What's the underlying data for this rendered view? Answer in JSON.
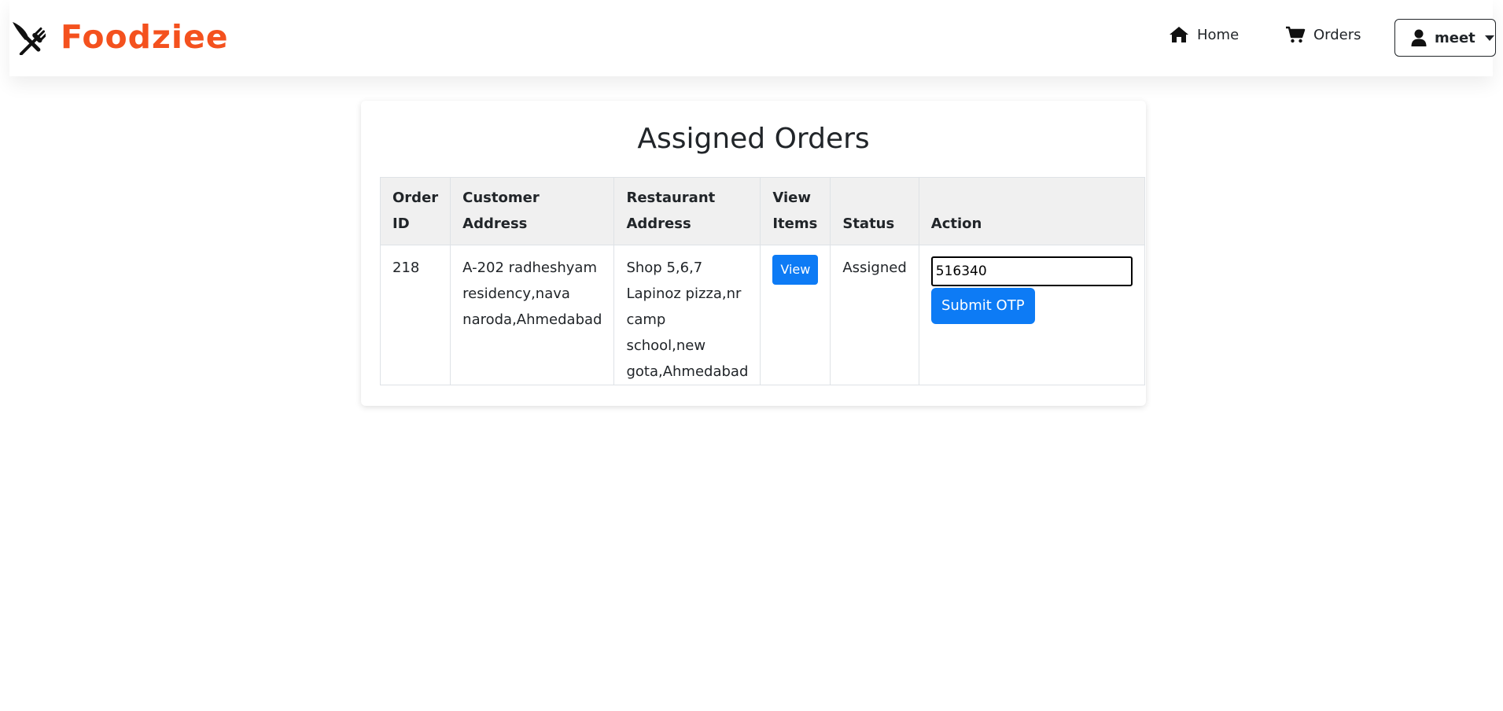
{
  "brand": {
    "name": "Foodziee",
    "color": "#f4511e",
    "icon": "fork-knife-icon"
  },
  "nav": {
    "home": {
      "label": "Home",
      "icon": "home-icon"
    },
    "orders": {
      "label": "Orders",
      "icon": "cart-icon"
    },
    "user": {
      "label": "meet",
      "icon": "user-icon"
    }
  },
  "page": {
    "title": "Assigned Orders"
  },
  "table": {
    "headers": [
      "Order ID",
      "Customer Address",
      "Restaurant Address",
      "View Items",
      "Status",
      "Action"
    ],
    "rows": [
      {
        "order_id": "218",
        "customer_address": "A-202 radheshyam residency,nava naroda,Ahmedabad",
        "restaurant_address": "Shop 5,6,7 Lapinoz pizza,nr camp school,new gota,Ahmedabad",
        "view_label": "View",
        "status": "Assigned",
        "otp_value": "516340",
        "submit_label": "Submit OTP"
      }
    ]
  },
  "colors": {
    "primary": "#0d7bf5",
    "header_bg": "#f0f0f0"
  }
}
